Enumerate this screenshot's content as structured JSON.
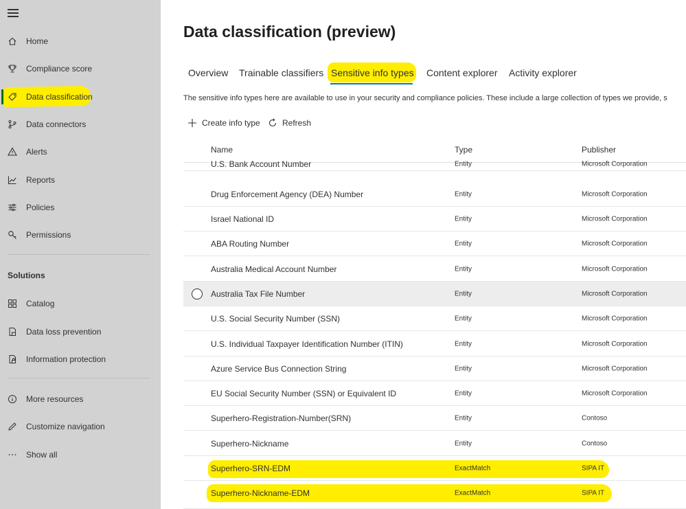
{
  "sidebar": {
    "nav": [
      {
        "label": "Home",
        "icon": "home-icon"
      },
      {
        "label": "Compliance score",
        "icon": "trophy-icon"
      },
      {
        "label": "Data classification",
        "icon": "tag-icon"
      },
      {
        "label": "Data connectors",
        "icon": "connector-icon"
      },
      {
        "label": "Alerts",
        "icon": "warning-icon"
      },
      {
        "label": "Reports",
        "icon": "chart-icon"
      },
      {
        "label": "Policies",
        "icon": "sliders-icon"
      },
      {
        "label": "Permissions",
        "icon": "key-icon"
      }
    ],
    "solutions_header": "Solutions",
    "solutions": [
      {
        "label": "Catalog",
        "icon": "catalog-icon"
      },
      {
        "label": "Data loss prevention",
        "icon": "dlp-icon"
      },
      {
        "label": "Information protection",
        "icon": "lock-doc-icon"
      }
    ],
    "footer": [
      {
        "label": "More resources",
        "icon": "info-icon"
      },
      {
        "label": "Customize navigation",
        "icon": "pencil-icon"
      },
      {
        "label": "Show all",
        "icon": "ellipsis-icon"
      }
    ],
    "highlight_color": "#ffee00"
  },
  "page": {
    "title": "Data classification (preview)",
    "description": "The sensitive info types here are available to use in your security and compliance policies. These include a large collection of types we provide, s"
  },
  "tabs": [
    {
      "label": "Overview"
    },
    {
      "label": "Trainable classifiers"
    },
    {
      "label": "Sensitive info types",
      "selected": true
    },
    {
      "label": "Content explorer"
    },
    {
      "label": "Activity explorer"
    }
  ],
  "commands": {
    "create_label": "Create info type",
    "refresh_label": "Refresh"
  },
  "table": {
    "columns": {
      "name": "Name",
      "type": "Type",
      "publisher": "Publisher"
    },
    "rows": [
      {
        "name": "U.S. Bank Account Number",
        "type": "Entity",
        "publisher": "Microsoft Corporation"
      },
      {
        "name": "Drug Enforcement Agency (DEA) Number",
        "type": "Entity",
        "publisher": "Microsoft Corporation"
      },
      {
        "name": "Israel National ID",
        "type": "Entity",
        "publisher": "Microsoft Corporation"
      },
      {
        "name": "ABA Routing Number",
        "type": "Entity",
        "publisher": "Microsoft Corporation"
      },
      {
        "name": "Australia Medical Account Number",
        "type": "Entity",
        "publisher": "Microsoft Corporation"
      },
      {
        "name": "Australia Tax File Number",
        "type": "Entity",
        "publisher": "Microsoft Corporation"
      },
      {
        "name": "U.S. Social Security Number (SSN)",
        "type": "Entity",
        "publisher": "Microsoft Corporation"
      },
      {
        "name": "U.S. Individual Taxpayer Identification Number (ITIN)",
        "type": "Entity",
        "publisher": "Microsoft Corporation"
      },
      {
        "name": "Azure Service Bus Connection String",
        "type": "Entity",
        "publisher": "Microsoft Corporation"
      },
      {
        "name": "EU Social Security Number (SSN) or Equivalent ID",
        "type": "Entity",
        "publisher": "Microsoft Corporation"
      },
      {
        "name": "Superhero-Registration-Number(SRN)",
        "type": "Entity",
        "publisher": "Contoso"
      },
      {
        "name": "Superhero-Nickname",
        "type": "Entity",
        "publisher": "Contoso"
      },
      {
        "name": "Superhero-SRN-EDM",
        "type": "ExactMatch",
        "publisher": "SIPA IT"
      },
      {
        "name": "Superhero-Nickname-EDM",
        "type": "ExactMatch",
        "publisher": "SIPA IT"
      }
    ]
  }
}
